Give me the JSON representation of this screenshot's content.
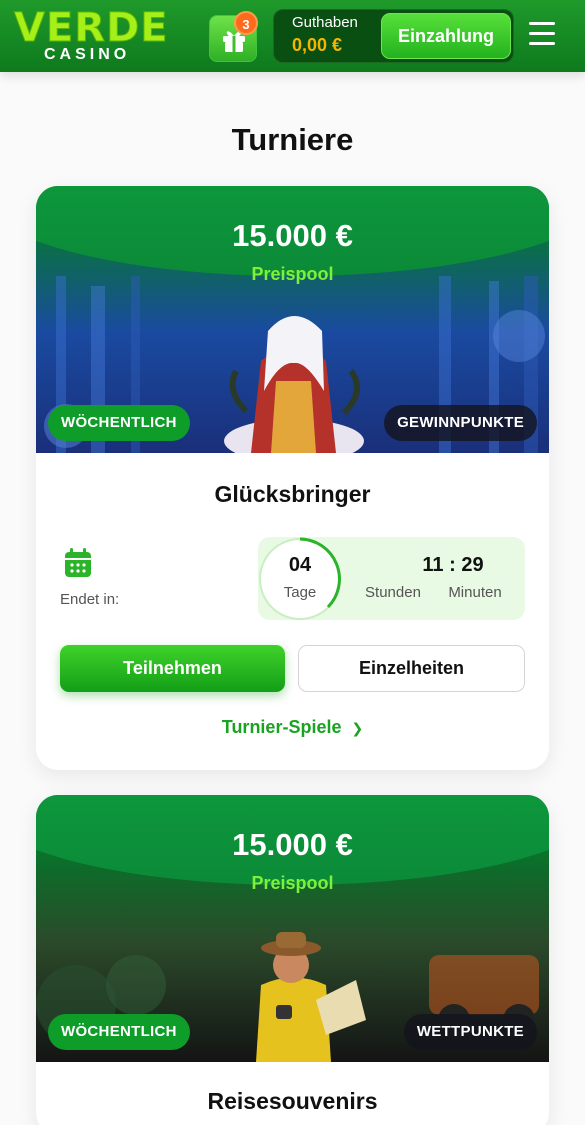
{
  "header": {
    "logo_main": "VERDE",
    "logo_sub": "CASINO",
    "gift_count": "3",
    "balance_label": "Guthaben",
    "balance_value": "0,00 €",
    "deposit_label": "Einzahlung"
  },
  "page_title": "Turniere",
  "tournaments": [
    {
      "prize": "15.000 €",
      "prize_label": "Preispool",
      "frequency": "WÖCHENTLICH",
      "scoring": "GEWINNPUNKTE",
      "title": "Glücksbringer",
      "ends_label": "Endet in:",
      "days": "04",
      "days_label": "Tage",
      "time": "11 : 29",
      "hours_label": "Stunden",
      "minutes_label": "Minuten",
      "join_label": "Teilnehmen",
      "details_label": "Einzelheiten",
      "games_label": "Turnier-Spiele"
    },
    {
      "prize": "15.000 €",
      "prize_label": "Preispool",
      "frequency": "WÖCHENTLICH",
      "scoring": "WETTPUNKTE",
      "title": "Reisesouvenirs"
    }
  ],
  "colors": {
    "header_green": "#0e7a1d",
    "accent_green": "#1aa321",
    "balance_gold": "#f5b400",
    "badge_orange": "#ff6a1c"
  },
  "icons": [
    "gift-icon",
    "hamburger-menu-icon",
    "calendar-icon",
    "chevron-down-icon"
  ]
}
